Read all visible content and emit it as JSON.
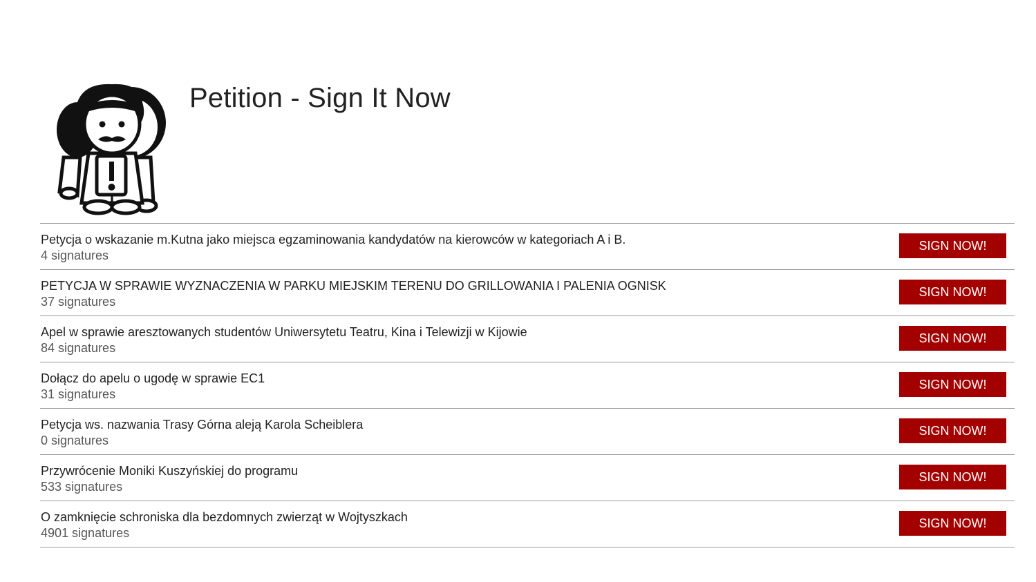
{
  "header": {
    "title": "Petition - Sign It Now",
    "logo_icon": "protesters-icon"
  },
  "petitions": [
    {
      "title": "Petycja o wskazanie m.Kutna jako miejsca egzaminowania kandydatów na kierowców w kategoriach A i B.",
      "signatures": "4 signatures",
      "button": "SIGN NOW!"
    },
    {
      "title": "PETYCJA W SPRAWIE WYZNACZENIA W PARKU MIEJSKIM TERENU DO GRILLOWANIA I PALENIA OGNISK",
      "signatures": "37 signatures",
      "button": "SIGN NOW!"
    },
    {
      "title": "Apel w sprawie aresztowanych studentów Uniwersytetu Teatru, Kina i Telewizji w Kijowie",
      "signatures": "84 signatures",
      "button": "SIGN NOW!"
    },
    {
      "title": "Dołącz do apelu o ugodę w sprawie EC1",
      "signatures": "31 signatures",
      "button": "SIGN NOW!"
    },
    {
      "title": "Petycja ws. nazwania Trasy Górna aleją Karola Scheiblera",
      "signatures": "0 signatures",
      "button": "SIGN NOW!"
    },
    {
      "title": "Przywrócenie Moniki Kuszyńskiej do programu",
      "signatures": "533 signatures",
      "button": "SIGN NOW!"
    },
    {
      "title": "O zamknięcie schroniska dla bezdomnych zwierząt w Wojtyszkach",
      "signatures": "4901 signatures",
      "button": "SIGN NOW!"
    }
  ],
  "colors": {
    "button_bg": "#a30000",
    "button_text": "#ffffff",
    "divider": "#999999"
  }
}
